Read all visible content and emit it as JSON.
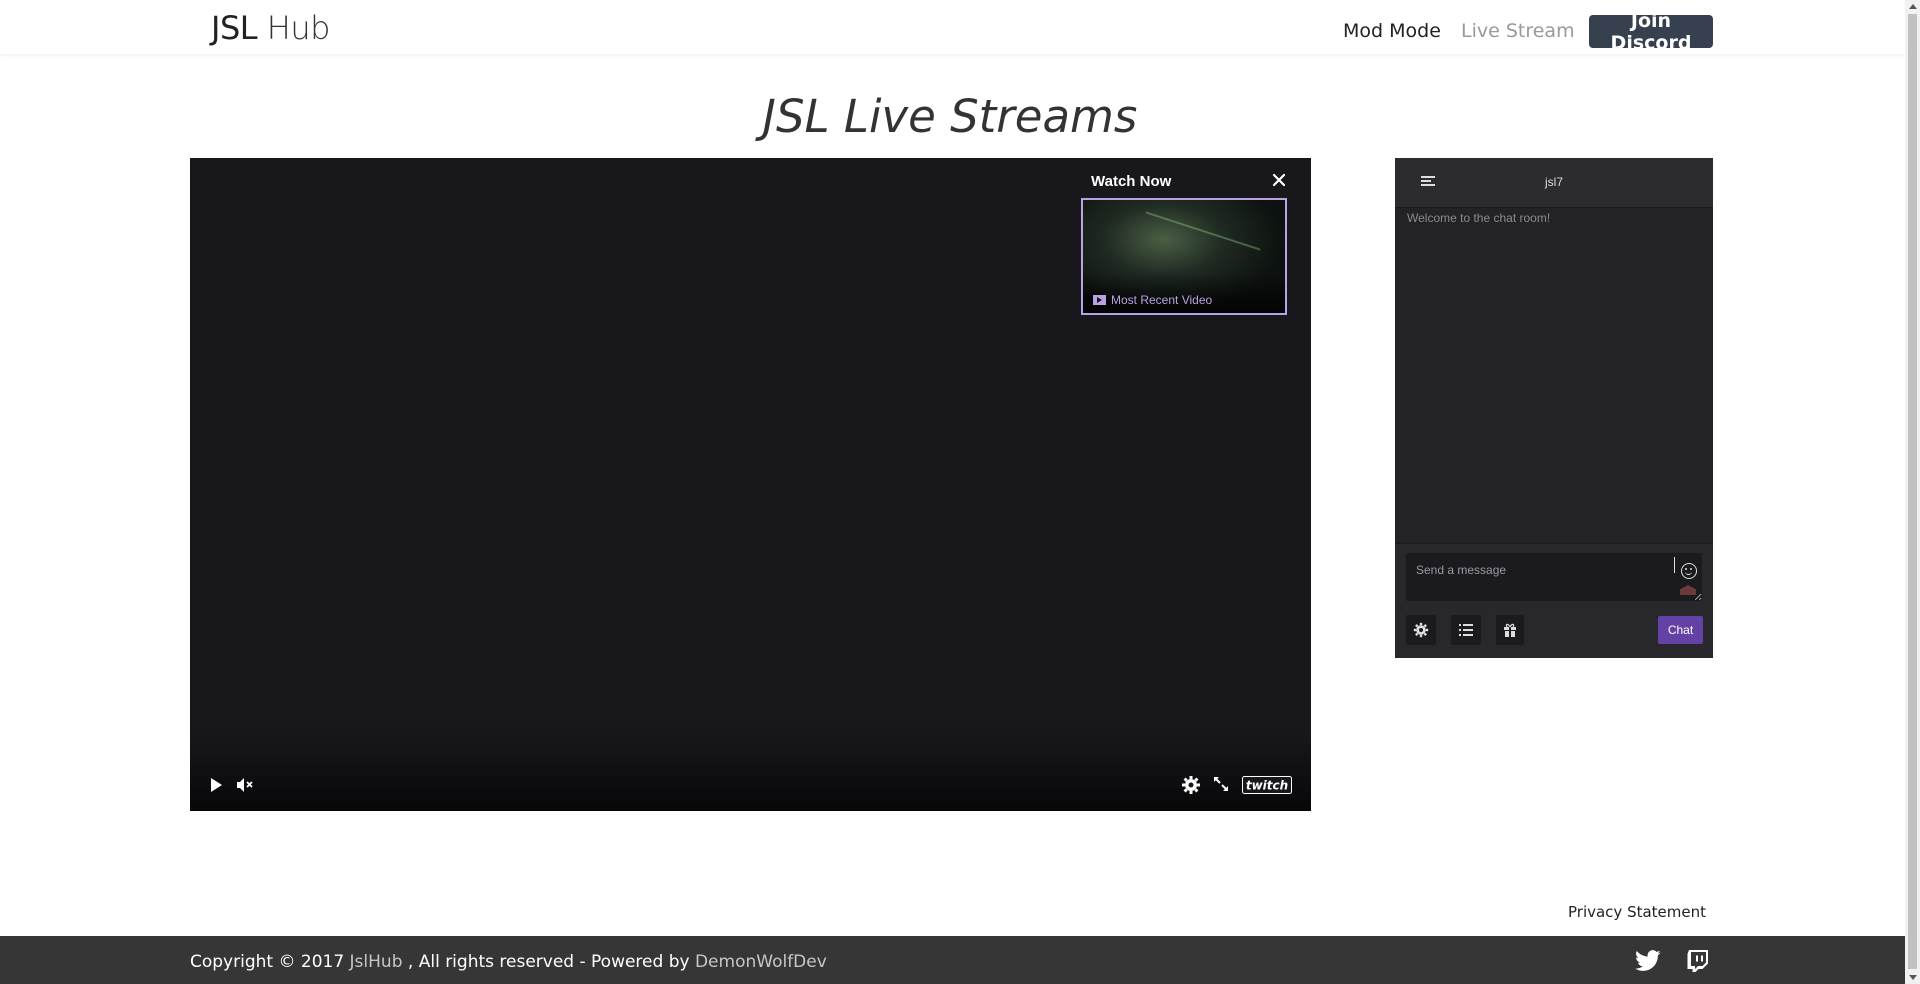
{
  "navbar": {
    "brand_bold": "JSL",
    "brand_light": "Hub",
    "links": [
      "Mod Mode",
      "Live Stream"
    ],
    "discord_label": "Join Discord"
  },
  "page": {
    "title": "JSL Live Streams"
  },
  "player": {
    "watch_now_title": "Watch Now",
    "thumbnail_label": "Most Recent Video",
    "logo_text": "twitch"
  },
  "chat": {
    "channel": "jsl7",
    "welcome": "Welcome to the chat room!",
    "input_placeholder": "Send a message",
    "send_label": "Chat"
  },
  "privacy_label": "Privacy Statement",
  "footer": {
    "copyright_prefix": "Copyright © 2017 ",
    "company_link": "JslHub",
    "copyright_mid": " , All rights reserved - Powered by ",
    "powered_link": "DemonWolfDev"
  },
  "colors": {
    "discord_button": "#36404e",
    "player_bg": "#18171c",
    "chat_bg": "#232226",
    "chat_button": "#6441a4",
    "footer_bg": "#363636",
    "thumbnail_border": "#b9a3e3"
  }
}
